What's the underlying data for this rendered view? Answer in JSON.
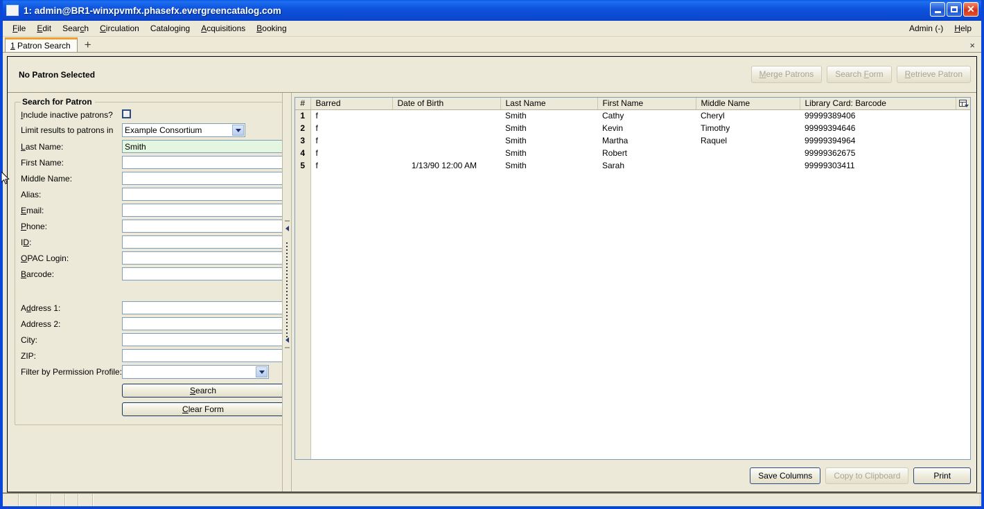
{
  "window": {
    "title": "1: admin@BR1-winxpvmfx.phasefx.evergreencatalog.com",
    "icon": "window-icon",
    "minimize": "minimize-icon",
    "maximize": "maximize-icon",
    "close": "✕"
  },
  "menubar": {
    "items": [
      {
        "label": "File",
        "accel": "F"
      },
      {
        "label": "Edit",
        "accel": "E"
      },
      {
        "label": "Search",
        "accel": "c"
      },
      {
        "label": "Circulation",
        "accel": "C"
      },
      {
        "label": "Cataloging",
        "accel": "g"
      },
      {
        "label": "Acquisitions",
        "accel": "A"
      },
      {
        "label": "Booking",
        "accel": "B"
      }
    ],
    "right": [
      {
        "label": "Admin (-)",
        "accel": ""
      },
      {
        "label": "Help",
        "accel": "H"
      }
    ]
  },
  "tabbar": {
    "active_tab": "1 Patron Search",
    "add_tab": "+",
    "close_all": "×"
  },
  "patron_bar": {
    "status": "No Patron Selected",
    "buttons": [
      {
        "label": "Merge Patrons",
        "enabled": false
      },
      {
        "label": "Search Form",
        "enabled": false
      },
      {
        "label": "Retrieve Patron",
        "enabled": false
      }
    ]
  },
  "search_form": {
    "legend": "Search for Patron",
    "include_inactive": {
      "label": "Include inactive patrons?",
      "checked": false
    },
    "limit_results": {
      "label": "Limit results to patrons in",
      "value": "Example Consortium"
    },
    "fields": [
      {
        "label": "Last Name:",
        "value": "Smith",
        "focused": true,
        "name": "last-name"
      },
      {
        "label": "First Name:",
        "value": "",
        "focused": false,
        "name": "first-name"
      },
      {
        "label": "Middle Name:",
        "value": "",
        "focused": false,
        "name": "middle-name"
      },
      {
        "label": "Alias:",
        "value": "",
        "focused": false,
        "name": "alias"
      },
      {
        "label": "Email:",
        "value": "",
        "focused": false,
        "name": "email"
      },
      {
        "label": "Phone:",
        "value": "",
        "focused": false,
        "name": "phone"
      },
      {
        "label": "ID:",
        "value": "",
        "focused": false,
        "name": "id"
      },
      {
        "label": "OPAC Login:",
        "value": "",
        "focused": false,
        "name": "opac-login"
      },
      {
        "label": "Barcode:",
        "value": "",
        "focused": false,
        "name": "barcode"
      }
    ],
    "address_fields": [
      {
        "label": "Address 1:",
        "value": "",
        "name": "address-1"
      },
      {
        "label": "Address 2:",
        "value": "",
        "name": "address-2"
      },
      {
        "label": "City:",
        "value": "",
        "name": "city"
      },
      {
        "label": "ZIP:",
        "value": "",
        "name": "zip"
      }
    ],
    "permission_profile": {
      "label": "Filter by Permission Profile:",
      "value": ""
    },
    "search_button": "Search",
    "clear_button": "Clear Form"
  },
  "results": {
    "columns": [
      "#",
      "Barred",
      "Date of Birth",
      "Last Name",
      "First Name",
      "Middle Name",
      "Library Card: Barcode"
    ],
    "column_picker_icon": "column-picker-icon",
    "rows": [
      {
        "num": "1",
        "barred": "f",
        "dob": "",
        "last": "Smith",
        "first": "Cathy",
        "middle": "Cheryl",
        "barcode": "99999389406"
      },
      {
        "num": "2",
        "barred": "f",
        "dob": "",
        "last": "Smith",
        "first": "Kevin",
        "middle": "Timothy",
        "barcode": "99999394646"
      },
      {
        "num": "3",
        "barred": "f",
        "dob": "",
        "last": "Smith",
        "first": "Martha",
        "middle": "Raquel",
        "barcode": "99999394964"
      },
      {
        "num": "4",
        "barred": "f",
        "dob": "",
        "last": "Smith",
        "first": "Robert",
        "middle": "",
        "barcode": "99999362675"
      },
      {
        "num": "5",
        "barred": "f",
        "dob": "1/13/90 12:00 AM",
        "last": "Smith",
        "first": "Sarah",
        "middle": "",
        "barcode": "99999303411"
      }
    ],
    "actions": [
      {
        "label": "Save Columns",
        "enabled": true
      },
      {
        "label": "Copy to Clipboard",
        "enabled": false
      },
      {
        "label": "Print",
        "enabled": true
      }
    ]
  },
  "statusbar": {
    "segments": [
      "",
      "",
      "",
      "",
      "",
      "",
      ""
    ]
  },
  "colors": {
    "title_blue": "#0b46cd",
    "window_border": "#0a46d8",
    "chrome": "#ece9d8",
    "focused_field": "#e3f6df",
    "tab_accent": "#f0a030",
    "default_button_border": "#16335f"
  }
}
